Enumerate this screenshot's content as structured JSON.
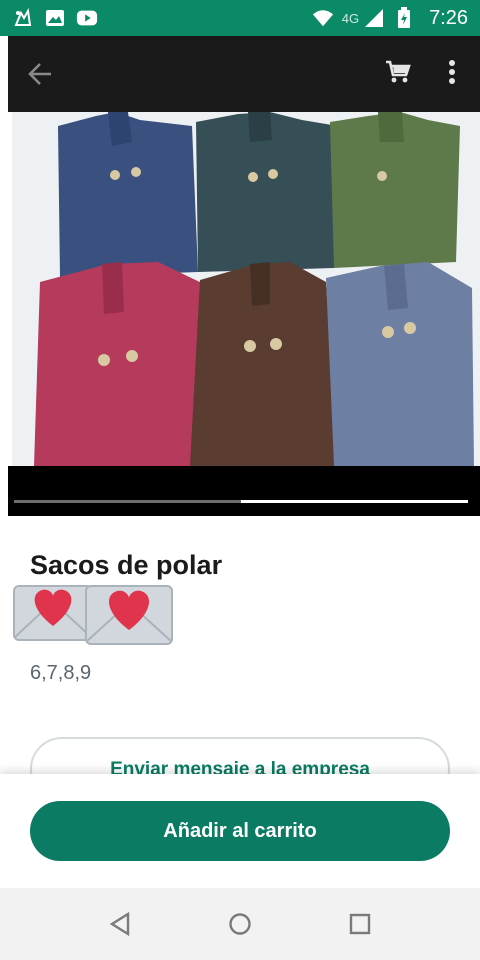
{
  "status_bar": {
    "time": "7:26",
    "network": "4G",
    "icons": [
      "assistant-icon",
      "image-icon",
      "youtube-icon",
      "wifi-icon",
      "signal-icon",
      "battery-charging-icon"
    ]
  },
  "app_bar": {
    "icons": [
      "back-arrow-icon",
      "cart-icon",
      "more-vert-icon"
    ]
  },
  "product": {
    "title": "Sacos de polar",
    "emoji": [
      "love-letter-icon",
      "love-letter-icon"
    ],
    "price": "6,7,8,9",
    "image_alt": "fleece-jackets-photo"
  },
  "carousel": {
    "progress": 0.5
  },
  "buttons": {
    "message": "Enviar mensaje a la empresa",
    "add_to_cart": "Añadir al carrito"
  },
  "nav_bar": {
    "icons": [
      "back-triangle-icon",
      "home-circle-icon",
      "recents-square-icon"
    ]
  },
  "colors": {
    "status_bar": "#0b8a67",
    "accent": "#0b7c63"
  }
}
